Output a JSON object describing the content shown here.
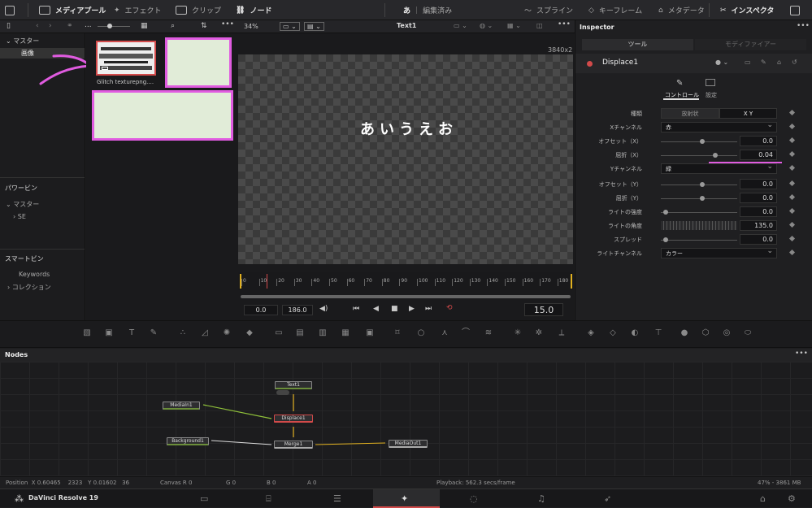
{
  "topbar": {
    "media_pool": "メディアプール",
    "effects": "エフェクト",
    "clips": "クリップ",
    "nodes": "ノード",
    "project_name": "あ",
    "project_status": "編集済み",
    "spline": "スプライン",
    "keyframes": "キーフレーム",
    "metadata": "メタデータ",
    "inspector": "インスペクタ"
  },
  "toolbar": {
    "zoom": "34%",
    "viewer_title": "Text1",
    "resolution": "3840x2",
    "ellipsis": "...",
    "dots": "•••"
  },
  "media_pool": {
    "master": "マスター",
    "selected_bin": "画像",
    "clip_name": "Glitch texturepng....",
    "power_bins_title": "パワービン",
    "power_bins_master": "マスター",
    "power_bins_child": "SE",
    "smart_bins_title": "スマートビン",
    "smart_keywords": "Keywords",
    "smart_collection": "コレクション"
  },
  "viewer": {
    "text": "あいうえお",
    "ruler_labels": [
      "0",
      "10",
      "20",
      "30",
      "40",
      "50",
      "60",
      "70",
      "80",
      "90",
      "100",
      "110",
      "120",
      "130",
      "140",
      "150",
      "160",
      "170",
      "180"
    ],
    "tc_in": "0.0",
    "tc_out": "186.0",
    "current_frame": "15.0"
  },
  "inspector": {
    "title": "Inspector",
    "tab_tools": "ツール",
    "tab_modifier": "モディファイアー",
    "node_name": "Displace1",
    "sub_controls": "コントロール",
    "sub_settings": "設定",
    "params": {
      "type_label": "種類",
      "type_radial": "放射状",
      "type_xy": "X Y",
      "x_channel_label": "Xチャンネル",
      "x_channel_value": "赤",
      "offset_x_label": "オフセット（X）",
      "offset_x_value": "0.0",
      "refraction_x_label": "屈折（X）",
      "refraction_x_value": "0.04",
      "y_channel_label": "Yチャンネル",
      "y_channel_value": "緑",
      "offset_y_label": "オフセット（Y）",
      "offset_y_value": "0.0",
      "refraction_y_label": "屈折（Y）",
      "refraction_y_value": "0.0",
      "light_strength_label": "ライトの強度",
      "light_strength_value": "0.0",
      "light_angle_label": "ライトの角度",
      "light_angle_value": "135.0",
      "spread_label": "スプレッド",
      "spread_value": "0.0",
      "light_channel_label": "ライトチャンネル",
      "light_channel_value": "カラー"
    }
  },
  "nodes": {
    "title": "Nodes",
    "text1": "Text1",
    "media_in1": "MediaIn1",
    "displace1": "Displace1",
    "background1": "Background1",
    "merge1": "Merge1",
    "media_out1": "MediaOut1"
  },
  "statusbar": {
    "position": "Position  X 0.60465    2323   Y 0.01602   36",
    "canvas": "Canvas  R 0",
    "g": "G 0",
    "b": "B 0",
    "a": "A 0",
    "playback": "Playback: 562.3 secs/frame",
    "memory": "47% - 3861 MB"
  },
  "app": {
    "name": "DaVinci Resolve 19"
  },
  "colors": {
    "annotation_magenta": "#e05be0",
    "node_green": "#6b8e3a",
    "node_yellow": "#e0b020",
    "selected_red": "#d24a4a"
  }
}
